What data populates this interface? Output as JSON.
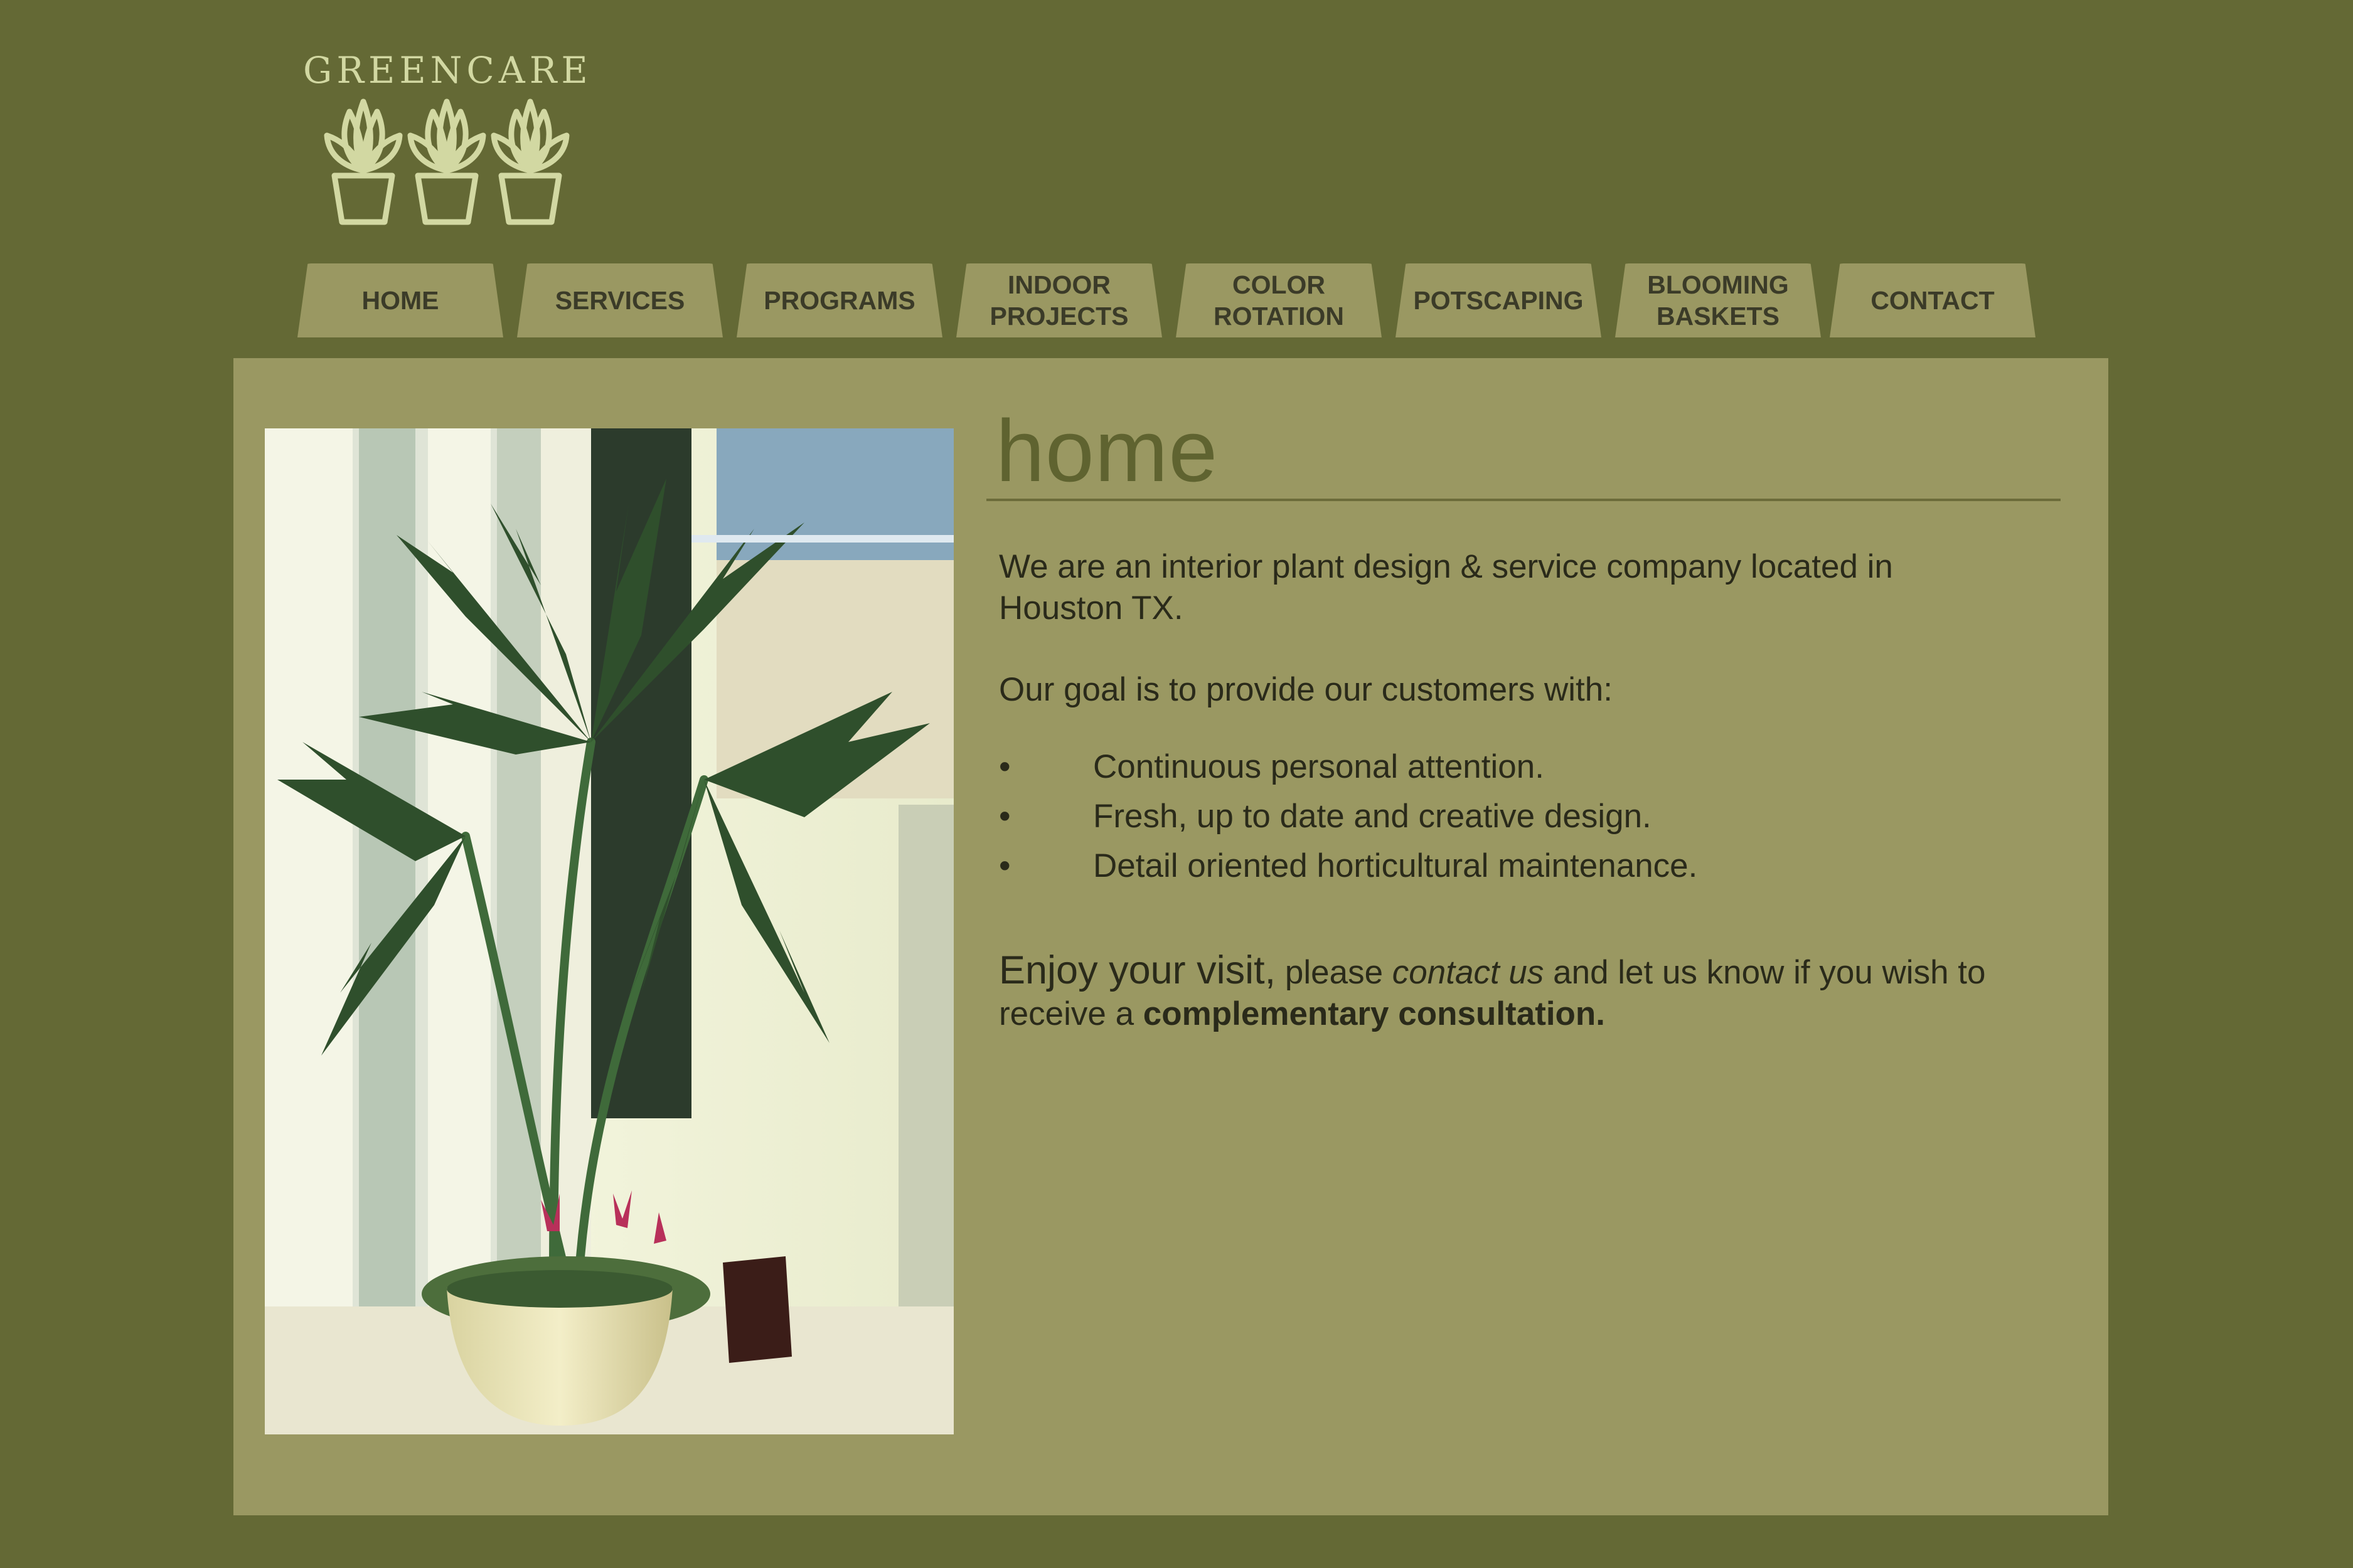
{
  "brand": {
    "name": "GREENCARE",
    "logo_icon": "potted-plants-icon"
  },
  "nav": {
    "items": [
      {
        "label": "HOME"
      },
      {
        "label": "SERVICES"
      },
      {
        "label": "PROGRAMS"
      },
      {
        "label": "INDOOR\nPROJECTS"
      },
      {
        "label": "COLOR\nROTATION"
      },
      {
        "label": "POTSCAPING"
      },
      {
        "label": "BLOOMING\nBASKETS"
      },
      {
        "label": "CONTACT"
      }
    ]
  },
  "main": {
    "title": "home",
    "intro": "We are an interior plant design & service company located in Houston TX.",
    "goal": "Our goal is to provide our customers with:",
    "bullet_char": "•",
    "bullets": [
      "Continuous personal attention.",
      "Fresh, up to date and creative design.",
      "Detail oriented horticultural maintenance."
    ],
    "closing": {
      "lead": "Enjoy your visit,",
      "pre_link": " please ",
      "link": "contact us",
      "post_link": " and let us know if you wish to receive a ",
      "bold": "complementary consultation."
    }
  },
  "colors": {
    "background": "#646935",
    "panel": "#9a9862",
    "tab": "#9a9862",
    "logo": "#d2d8a2",
    "title": "#5f6330",
    "text": "#2a2a1a"
  }
}
